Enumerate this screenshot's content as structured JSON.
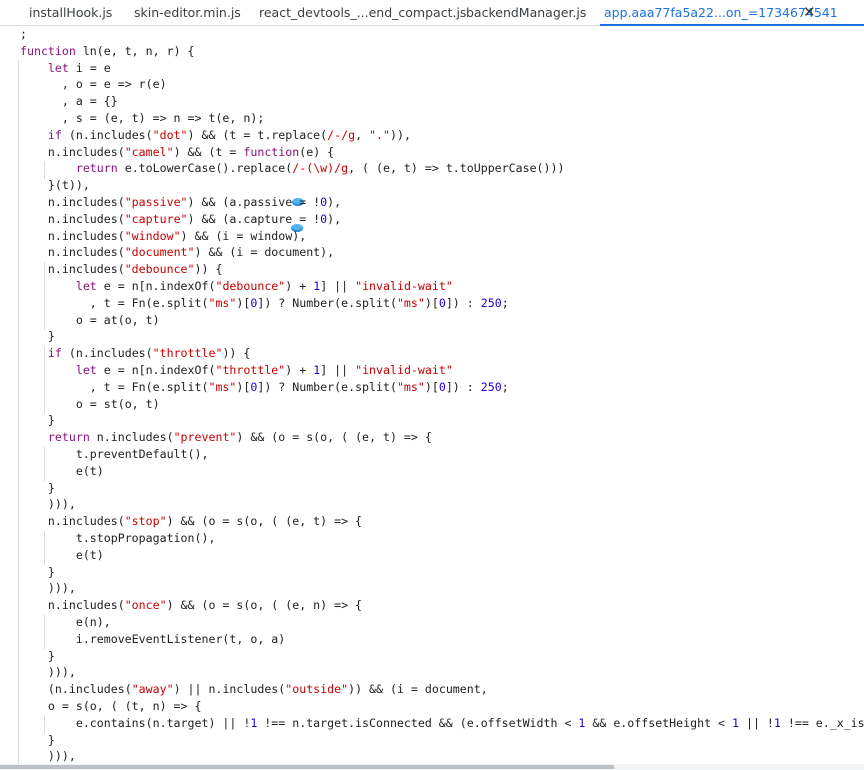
{
  "tabs": [
    {
      "label": "installHook.js",
      "active": false
    },
    {
      "label": "skin-editor.min.js",
      "active": false
    },
    {
      "label": "react_devtools_...end_compact.js",
      "active": false
    },
    {
      "label": "backendManager.js",
      "active": false
    },
    {
      "label": "app.aaa77fa5a22...on_=1734674541",
      "active": true
    }
  ],
  "close_glyph": "✕",
  "colors": {
    "keyword": "#881280",
    "string": "#c80000",
    "number": "#1c00cf",
    "text": "#202124",
    "active_tab": "#1a73e8"
  },
  "code_lines": [
    [
      [
        "t",
        ";"
      ]
    ],
    [
      [
        "k",
        "function"
      ],
      [
        "t",
        " ln(e, t, n, r) {"
      ]
    ],
    [
      [
        "t",
        "    "
      ],
      [
        "k",
        "let"
      ],
      [
        "t",
        " i = e"
      ]
    ],
    [
      [
        "t",
        "      , o = e => r(e)"
      ]
    ],
    [
      [
        "t",
        "      , a = {}"
      ]
    ],
    [
      [
        "t",
        "      , s = (e, t) => n => t(e, n);"
      ]
    ],
    [
      [
        "t",
        "    "
      ],
      [
        "k",
        "if"
      ],
      [
        "t",
        " (n.includes("
      ],
      [
        "s",
        "\"dot\""
      ],
      [
        "t",
        ") && (t = t.replace("
      ],
      [
        "s",
        "/-/g"
      ],
      [
        "t",
        ", "
      ],
      [
        "s",
        "\".\""
      ],
      [
        "t",
        ")),"
      ]
    ],
    [
      [
        "t",
        "    n.includes("
      ],
      [
        "s",
        "\"camel\""
      ],
      [
        "t",
        ") && (t = "
      ],
      [
        "k",
        "function"
      ],
      [
        "t",
        "(e) {"
      ]
    ],
    [
      [
        "t",
        "        "
      ],
      [
        "k",
        "return"
      ],
      [
        "t",
        " e.toLowerCase().replace("
      ],
      [
        "s",
        "/-(\\w)/g"
      ],
      [
        "t",
        ", ( (e, t) => t.toUpperCase()))"
      ]
    ],
    [
      [
        "t",
        "    }(t)),"
      ]
    ],
    [
      [
        "t",
        "    n.includes("
      ],
      [
        "s",
        "\"passive\""
      ],
      [
        "t",
        ") && (a.passive = !"
      ],
      [
        "n",
        "0"
      ],
      [
        "t",
        "),"
      ]
    ],
    [
      [
        "t",
        "    n.includes("
      ],
      [
        "s",
        "\"capture\""
      ],
      [
        "t",
        ") && (a.capture = !"
      ],
      [
        "n",
        "0"
      ],
      [
        "t",
        "),"
      ]
    ],
    [
      [
        "t",
        "    n.includes("
      ],
      [
        "s",
        "\"window\""
      ],
      [
        "t",
        ") && (i = window),"
      ]
    ],
    [
      [
        "t",
        "    n.includes("
      ],
      [
        "s",
        "\"document\""
      ],
      [
        "t",
        ") && (i = document),"
      ]
    ],
    [
      [
        "t",
        "    n.includes("
      ],
      [
        "s",
        "\"debounce\""
      ],
      [
        "t",
        ")) {"
      ]
    ],
    [
      [
        "t",
        "        "
      ],
      [
        "k",
        "let"
      ],
      [
        "t",
        " e = n[n.indexOf("
      ],
      [
        "s",
        "\"debounce\""
      ],
      [
        "t",
        ") + "
      ],
      [
        "n",
        "1"
      ],
      [
        "t",
        "] || "
      ],
      [
        "s",
        "\"invalid-wait\""
      ]
    ],
    [
      [
        "t",
        "          , t = Fn(e.split("
      ],
      [
        "s",
        "\"ms\""
      ],
      [
        "t",
        ")["
      ],
      [
        "n",
        "0"
      ],
      [
        "t",
        "]) ? Number(e.split("
      ],
      [
        "s",
        "\"ms\""
      ],
      [
        "t",
        ")["
      ],
      [
        "n",
        "0"
      ],
      [
        "t",
        "]) : "
      ],
      [
        "n",
        "250"
      ],
      [
        "t",
        ";"
      ]
    ],
    [
      [
        "t",
        "        o = at(o, t)"
      ]
    ],
    [
      [
        "t",
        "    }"
      ]
    ],
    [
      [
        "t",
        "    "
      ],
      [
        "k",
        "if"
      ],
      [
        "t",
        " (n.includes("
      ],
      [
        "s",
        "\"throttle\""
      ],
      [
        "t",
        ")) {"
      ]
    ],
    [
      [
        "t",
        "        "
      ],
      [
        "k",
        "let"
      ],
      [
        "t",
        " e = n[n.indexOf("
      ],
      [
        "s",
        "\"throttle\""
      ],
      [
        "t",
        ") + "
      ],
      [
        "n",
        "1"
      ],
      [
        "t",
        "] || "
      ],
      [
        "s",
        "\"invalid-wait\""
      ]
    ],
    [
      [
        "t",
        "          , t = Fn(e.split("
      ],
      [
        "s",
        "\"ms\""
      ],
      [
        "t",
        ")["
      ],
      [
        "n",
        "0"
      ],
      [
        "t",
        "]) ? Number(e.split("
      ],
      [
        "s",
        "\"ms\""
      ],
      [
        "t",
        ")["
      ],
      [
        "n",
        "0"
      ],
      [
        "t",
        "]) : "
      ],
      [
        "n",
        "250"
      ],
      [
        "t",
        ";"
      ]
    ],
    [
      [
        "t",
        "        o = st(o, t)"
      ]
    ],
    [
      [
        "t",
        "    }"
      ]
    ],
    [
      [
        "t",
        "    "
      ],
      [
        "k",
        "return"
      ],
      [
        "t",
        " n.includes("
      ],
      [
        "s",
        "\"prevent\""
      ],
      [
        "t",
        ") && (o = s(o, ( (e, t) => {"
      ]
    ],
    [
      [
        "t",
        "        t.preventDefault(),"
      ]
    ],
    [
      [
        "t",
        "        e(t)"
      ]
    ],
    [
      [
        "t",
        "    }"
      ]
    ],
    [
      [
        "t",
        "    ))),"
      ]
    ],
    [
      [
        "t",
        "    n.includes("
      ],
      [
        "s",
        "\"stop\""
      ],
      [
        "t",
        ") && (o = s(o, ( (e, t) => {"
      ]
    ],
    [
      [
        "t",
        "        t.stopPropagation(),"
      ]
    ],
    [
      [
        "t",
        "        e(t)"
      ]
    ],
    [
      [
        "t",
        "    }"
      ]
    ],
    [
      [
        "t",
        "    ))),"
      ]
    ],
    [
      [
        "t",
        "    n.includes("
      ],
      [
        "s",
        "\"once\""
      ],
      [
        "t",
        ") && (o = s(o, ( (e, n) => {"
      ]
    ],
    [
      [
        "t",
        "        e(n),"
      ]
    ],
    [
      [
        "t",
        "        i.removeEventListener(t, o, a)"
      ]
    ],
    [
      [
        "t",
        "    }"
      ]
    ],
    [
      [
        "t",
        "    ))),"
      ]
    ],
    [
      [
        "t",
        "    (n.includes("
      ],
      [
        "s",
        "\"away\""
      ],
      [
        "t",
        ") || n.includes("
      ],
      [
        "s",
        "\"outside\""
      ],
      [
        "t",
        ")) && (i = document,"
      ]
    ],
    [
      [
        "t",
        "    o = s(o, ( (t, n) => {"
      ]
    ],
    [
      [
        "t",
        "        e.contains(n.target) || !"
      ],
      [
        "n",
        "1"
      ],
      [
        "t",
        " !== n.target.isConnected && (e.offsetWidth < "
      ],
      [
        "n",
        "1"
      ],
      [
        "t",
        " && e.offsetHeight < "
      ],
      [
        "n",
        "1"
      ],
      [
        "t",
        " || !"
      ],
      [
        "n",
        "1"
      ],
      [
        "t",
        " !== e._x_isShown && t(n))"
      ]
    ],
    [
      [
        "t",
        "    }"
      ]
    ],
    [
      [
        "t",
        "    ))),"
      ]
    ]
  ]
}
